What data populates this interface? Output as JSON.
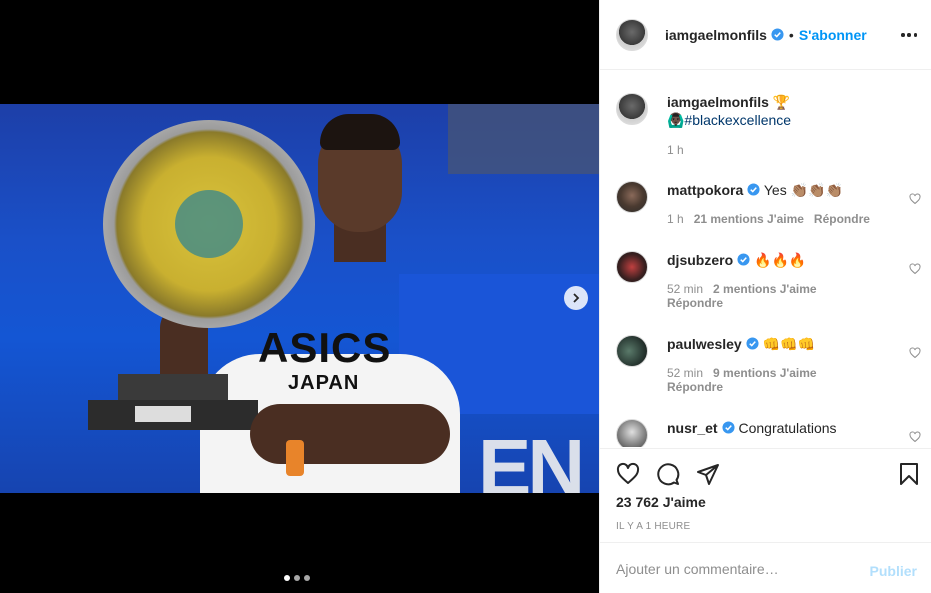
{
  "post": {
    "username": "iamgaelmonfils",
    "follow_label": "S'abonner",
    "separator": "•",
    "more_icon": "more-horizontal-icon"
  },
  "media": {
    "shirt_brand": "ASICS",
    "shirt_sub": "JAPAN",
    "banner_letters": "EN",
    "carousel_count": 3,
    "carousel_active": 1
  },
  "caption": {
    "username": "iamgaelmonfils",
    "emoji": "🏆",
    "hashtag": "🙆🏿‍♂️#blackexcellence",
    "time": "1 h"
  },
  "comments": [
    {
      "username": "mattpokora",
      "text": "Yes 👏🏽👏🏽👏🏽",
      "time": "1 h",
      "likes": "21 mentions J'aime",
      "reply": "Répondre"
    },
    {
      "username": "djsubzero",
      "text": "🔥🔥🔥",
      "time": "52 min",
      "likes": "2 mentions J'aime",
      "reply": "Répondre"
    },
    {
      "username": "paulwesley",
      "text": "👊👊👊",
      "time": "52 min",
      "likes": "9 mentions J'aime",
      "reply": "Répondre"
    },
    {
      "username": "nusr_et",
      "text": "Congratulations",
      "time": "",
      "likes": "",
      "reply": ""
    }
  ],
  "actions": {
    "likes_count": "23 762 J'aime",
    "timestamp": "IL Y A 1 HEURE"
  },
  "comment_box": {
    "placeholder": "Ajouter un commentaire…",
    "publish_label": "Publier"
  },
  "colors": {
    "link_blue": "#0095f6",
    "publish_disabled": "#b2dffc",
    "verified_blue": "#3897f0",
    "muted": "#8e8e8e"
  }
}
